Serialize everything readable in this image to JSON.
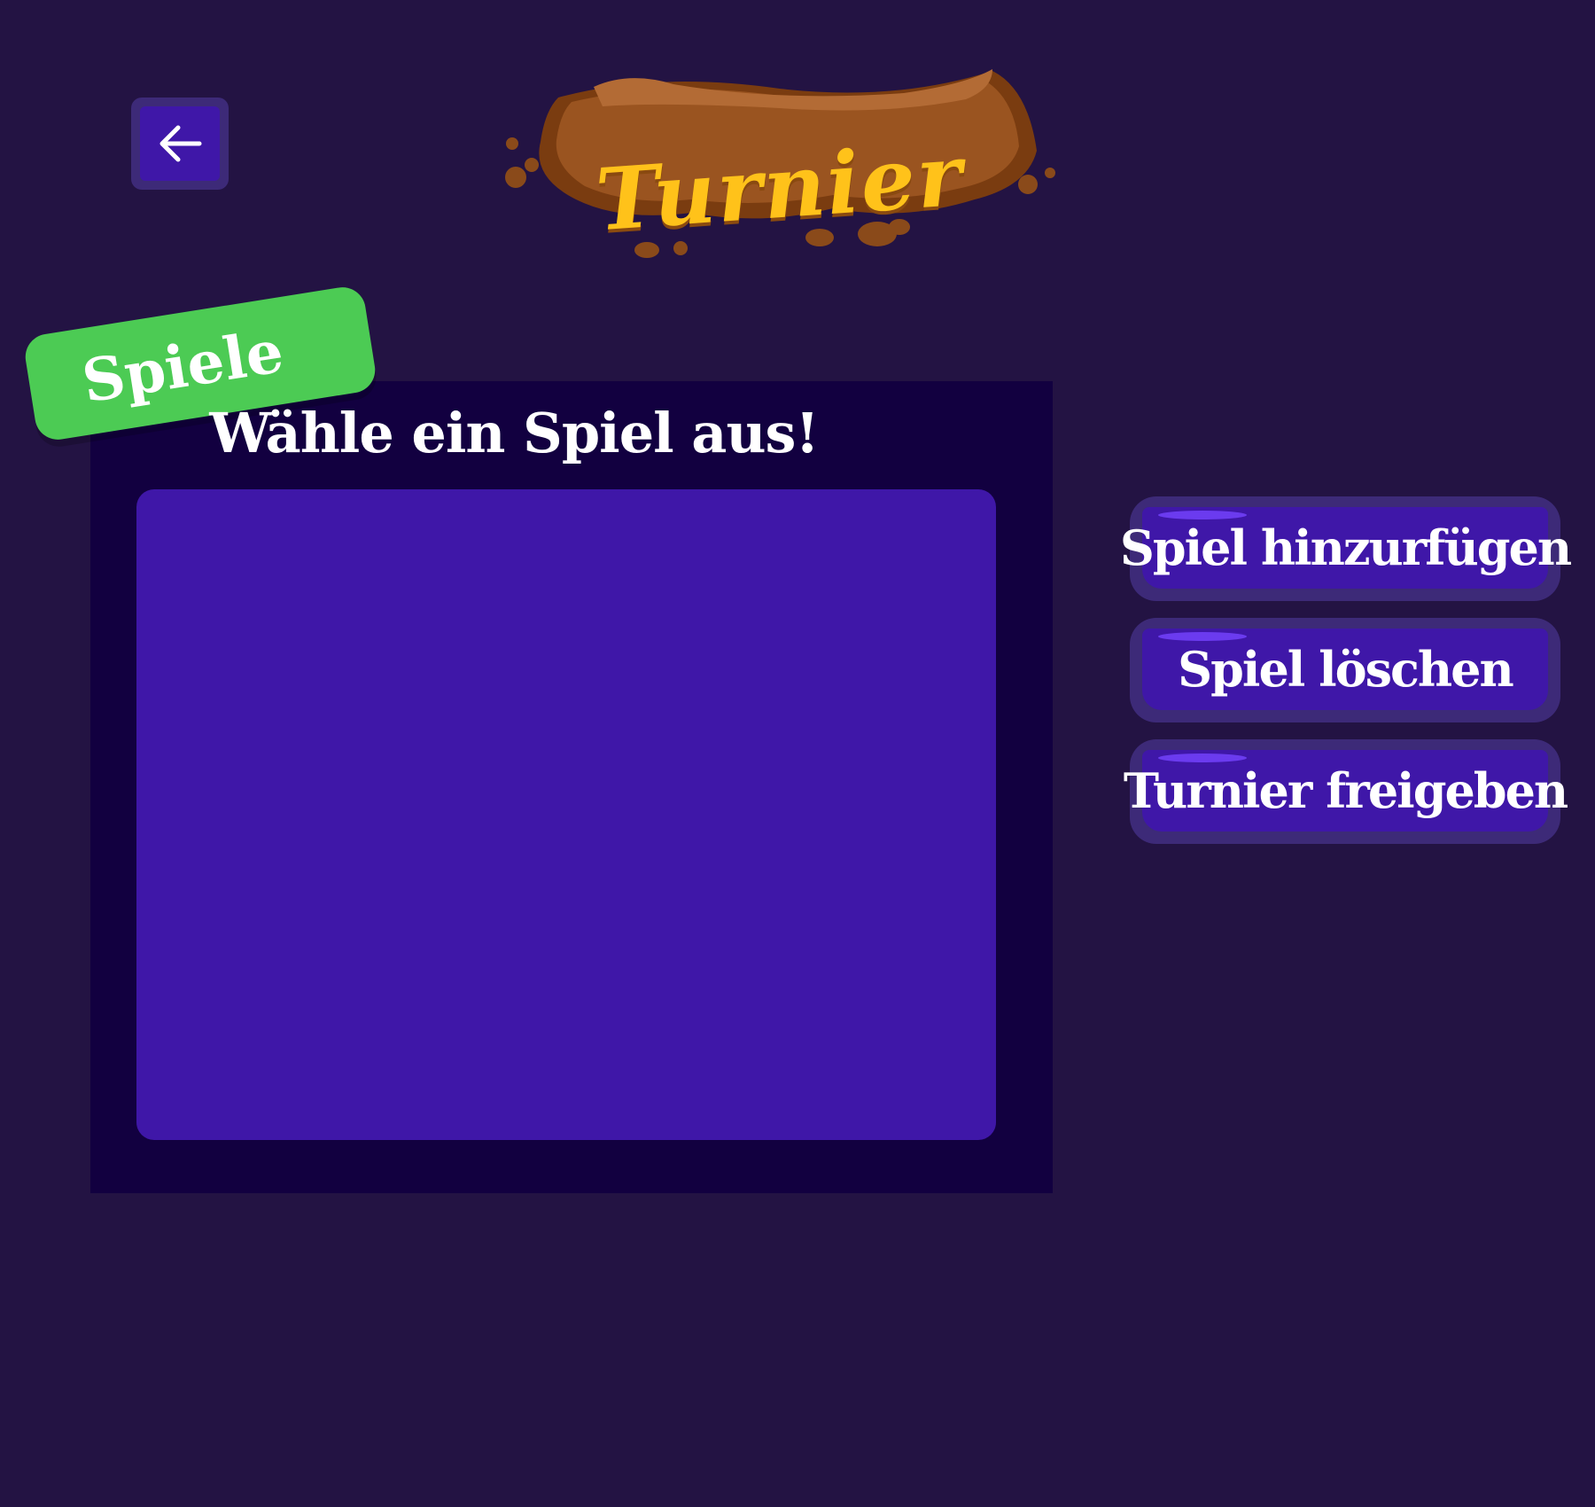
{
  "header": {
    "title": "Turnier",
    "back_icon": "arrow-left-icon"
  },
  "games_panel": {
    "tag_label": "Spiele",
    "heading": "Wähle ein Spiel aus!",
    "games": []
  },
  "actions": [
    {
      "label": "Spiel hinzurfügen"
    },
    {
      "label": "Spiel löschen"
    },
    {
      "label": "Turnier freigeben"
    }
  ],
  "colors": {
    "background": "#231343",
    "panel": "#120040",
    "list_area": "#3f17a8",
    "button_face": "#3f17a8",
    "button_border": "#3d2a78",
    "tag_green": "#4ccb54",
    "title_yellow": "#ffc21a",
    "banner_brown": "#8e4a1a"
  }
}
